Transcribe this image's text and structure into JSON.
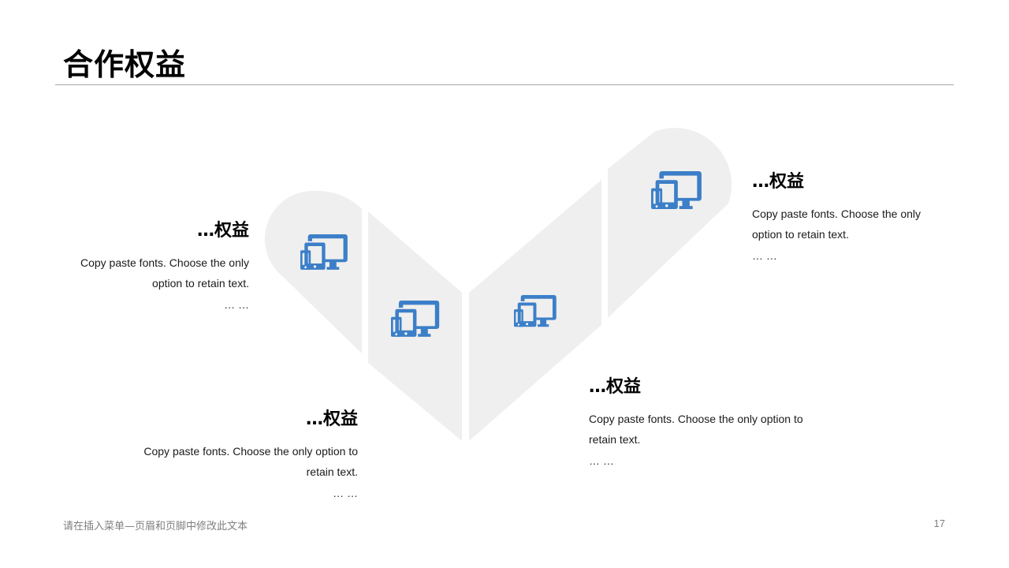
{
  "title": "合作权益",
  "colors": {
    "accent": "#3c7fc8",
    "shape_fill": "#efefef",
    "rule": "#a6a6a6"
  },
  "icon": "devices-icon",
  "items": [
    {
      "heading": "…权益",
      "line1": "Copy paste fonts. Choose the only",
      "line2": "option to retain text.",
      "dots": "… …"
    },
    {
      "heading": "…权益",
      "line1": "Copy paste fonts. Choose the only option to",
      "line2": "retain text.",
      "dots": "… …"
    },
    {
      "heading": "…权益",
      "line1": "Copy paste fonts. Choose the only option to",
      "line2": "retain text.",
      "dots": "… …"
    },
    {
      "heading": "…权益",
      "line1": "Copy paste fonts. Choose the only",
      "line2": "option to retain text.",
      "dots": "… …"
    }
  ],
  "footer": {
    "text": "请在插入菜单—页眉和页脚中修改此文本",
    "page_number": "17"
  }
}
